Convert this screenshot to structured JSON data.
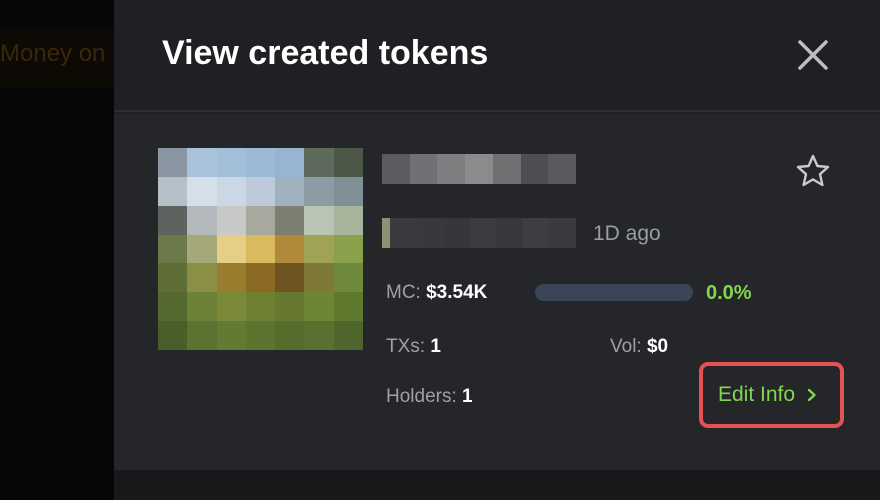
{
  "background": {
    "text": "Money on"
  },
  "modal": {
    "title": "View created tokens",
    "close_icon": "close-icon"
  },
  "token": {
    "age": "1D ago",
    "stats": {
      "mc_label": "MC:",
      "mc_value": "$3.54K",
      "bonding_progress_percent": "0.0%",
      "bonding_progress_fraction": 0.0,
      "txs_label": "TXs:",
      "txs_value": "1",
      "vol_label": "Vol:",
      "vol_value": "$0",
      "holders_label": "Holders:",
      "holders_value": "1"
    },
    "favorite_icon": "star-outline-icon",
    "edit_button": {
      "label": "Edit Info",
      "icon": "chevron-right-icon"
    }
  },
  "colors": {
    "accent_green": "#7fd74e",
    "highlight_red": "#e65252",
    "modal_bg": "#1f2023",
    "card_bg": "#25262a"
  }
}
